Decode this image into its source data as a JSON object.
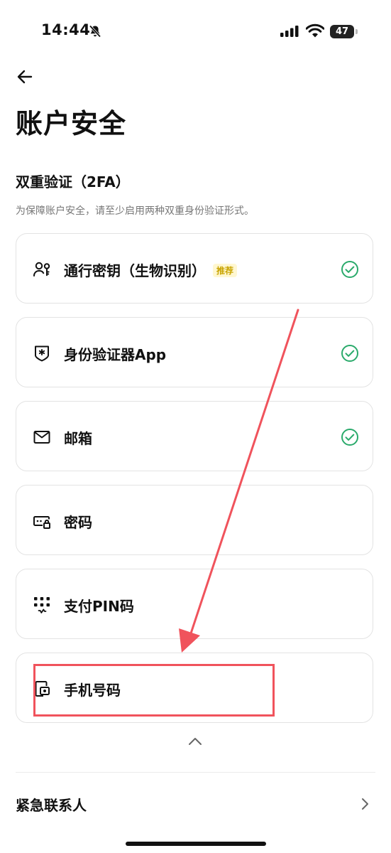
{
  "status_bar": {
    "time": "14:44",
    "battery": "47",
    "icons": [
      "bell-off-icon",
      "signal-icon",
      "wifi-icon",
      "battery-icon"
    ]
  },
  "header": {
    "back_icon": "arrow-left-icon",
    "title": "账户安全"
  },
  "twofa": {
    "title": "双重验证（2FA）",
    "description": "为保障账户安全，请至少启用两种双重身份验证形式。",
    "options": [
      {
        "label": "通行密钥（生物识别）",
        "badge": "推荐",
        "icon": "passkey-icon",
        "enabled": true
      },
      {
        "label": "身份验证器App",
        "icon": "authenticator-shield-icon",
        "enabled": true
      },
      {
        "label": "邮箱",
        "icon": "mail-icon",
        "enabled": true
      },
      {
        "label": "密码",
        "icon": "password-icon",
        "enabled": false
      },
      {
        "label": "支付PIN码",
        "icon": "pin-keypad-icon",
        "enabled": false
      },
      {
        "label": "手机号码",
        "icon": "phone-icon",
        "enabled": false
      }
    ],
    "check_color": "#2aaa6b",
    "collapse_icon": "chevron-up-icon"
  },
  "emergency": {
    "label": "紧急联系人",
    "icon": "chevron-right-icon"
  },
  "annotation": {
    "color": "#f0535c"
  }
}
